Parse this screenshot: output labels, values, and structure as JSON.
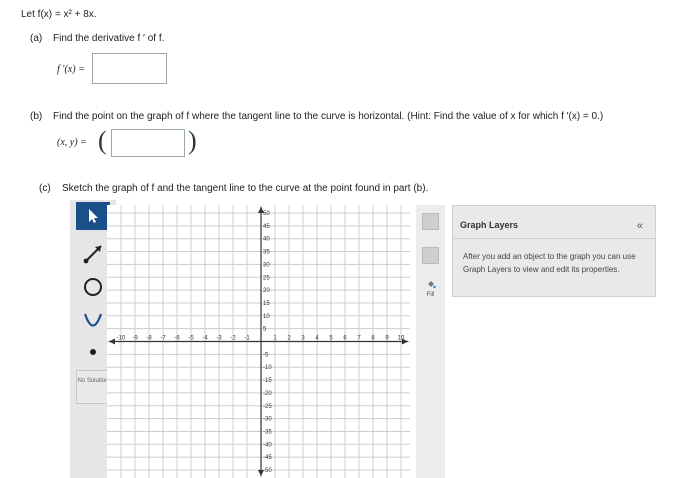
{
  "problem": {
    "intro": "Let f(x) = x² + 8x.",
    "part_a": {
      "label": "(a)",
      "text": "Find the derivative f ′ of f.",
      "answer_label": "f ′(x) =",
      "answer_value": ""
    },
    "part_b": {
      "label": "(b)",
      "text": "Find the point on the graph of f where the tangent line to the curve is horizontal. (Hint: Find the value of x for which f ′(x) = 0.)",
      "answer_label": "(x, y) =",
      "answer_value": ""
    },
    "part_c": {
      "label": "(c)",
      "text": "Sketch the graph of f and the tangent line to the curve at the point found in part (b)."
    }
  },
  "graph": {
    "x_ticks": [
      "-10",
      "-9",
      "-8",
      "-7",
      "-6",
      "-5",
      "-4",
      "-3",
      "-2",
      "-1",
      "1",
      "2",
      "3",
      "4",
      "5",
      "6",
      "7",
      "8",
      "9",
      "10"
    ],
    "y_pos_ticks": [
      "50",
      "45",
      "40",
      "35",
      "30",
      "25",
      "20",
      "15",
      "10",
      "5"
    ],
    "y_neg_ticks": [
      "-5",
      "-10",
      "-15",
      "-20",
      "-25",
      "-30",
      "-35",
      "-40",
      "-45",
      "-50"
    ],
    "xlim": [
      -10,
      10
    ],
    "ylim": [
      -50,
      50
    ]
  },
  "toolbar": {
    "tools": [
      {
        "name": "pointer-tool",
        "icon": "arrow-pointer-icon"
      },
      {
        "name": "line-tool",
        "icon": "line-segment-icon"
      },
      {
        "name": "circle-tool",
        "icon": "circle-icon"
      },
      {
        "name": "parabola-tool",
        "icon": "parabola-icon"
      },
      {
        "name": "point-tool",
        "icon": "dot-icon"
      }
    ],
    "no_solution_label": "No Solution"
  },
  "sidebar": {
    "fill_label": "Fill"
  },
  "layers_panel": {
    "title": "Graph Layers",
    "collapse": "«",
    "text": "After you add an object to the graph you can use Graph Layers to view and edit its properties."
  },
  "colors": {
    "active_tool": "#1a4f8a",
    "panel_bg": "#e9e9e9",
    "grid": "#c8cdd3",
    "axis": "#333333"
  }
}
